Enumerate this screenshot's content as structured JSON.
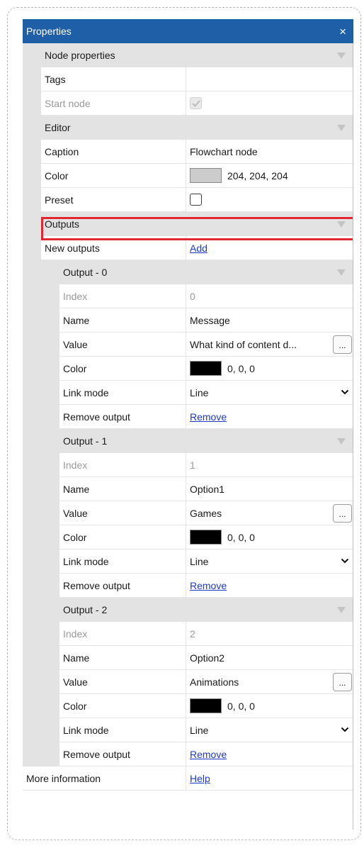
{
  "panel": {
    "title": "Properties",
    "close_glyph": "×"
  },
  "node_properties": {
    "header": "Node properties",
    "tags": {
      "label": "Tags",
      "value": ""
    },
    "start_node": {
      "label": "Start node",
      "checked": true
    }
  },
  "editor": {
    "header": "Editor",
    "caption": {
      "label": "Caption",
      "value": "Flowchart node"
    },
    "color": {
      "label": "Color",
      "value": "204, 204, 204",
      "swatch": "#cccccc"
    },
    "preset": {
      "label": "Preset",
      "checked": false
    }
  },
  "outputs": {
    "header": "Outputs",
    "new_outputs": {
      "label": "New outputs",
      "action": "Add"
    },
    "items": [
      {
        "header": "Output - 0",
        "index": {
          "label": "Index",
          "value": "0"
        },
        "name": {
          "label": "Name",
          "value": "Message"
        },
        "value": {
          "label": "Value",
          "value": "What kind of content d...",
          "button": "..."
        },
        "color": {
          "label": "Color",
          "value": "0, 0, 0",
          "swatch": "#000000"
        },
        "link_mode": {
          "label": "Link mode",
          "value": "Line"
        },
        "remove": {
          "label": "Remove output",
          "action": "Remove"
        }
      },
      {
        "header": "Output - 1",
        "index": {
          "label": "Index",
          "value": "1"
        },
        "name": {
          "label": "Name",
          "value": "Option1"
        },
        "value": {
          "label": "Value",
          "value": "Games",
          "button": "..."
        },
        "color": {
          "label": "Color",
          "value": "0, 0, 0",
          "swatch": "#000000"
        },
        "link_mode": {
          "label": "Link mode",
          "value": "Line"
        },
        "remove": {
          "label": "Remove output",
          "action": "Remove"
        }
      },
      {
        "header": "Output - 2",
        "index": {
          "label": "Index",
          "value": "2"
        },
        "name": {
          "label": "Name",
          "value": "Option2"
        },
        "value": {
          "label": "Value",
          "value": "Animations",
          "button": "..."
        },
        "color": {
          "label": "Color",
          "value": "0, 0, 0",
          "swatch": "#000000"
        },
        "link_mode": {
          "label": "Link mode",
          "value": "Line"
        },
        "remove": {
          "label": "Remove output",
          "action": "Remove"
        }
      }
    ]
  },
  "more_information": {
    "label": "More information",
    "action": "Help"
  }
}
